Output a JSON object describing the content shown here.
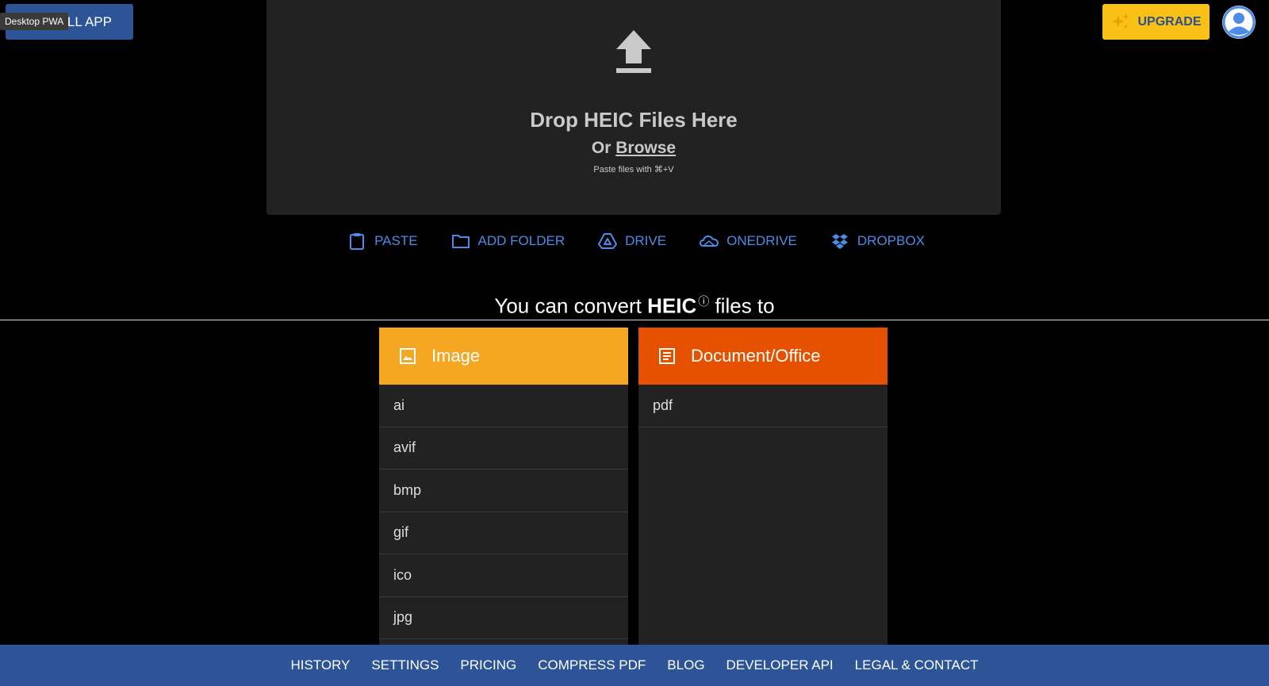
{
  "topbar": {
    "install_label": "INSTALL APP",
    "tooltip": "Desktop PWA",
    "upgrade_label": "UPGRADE"
  },
  "dropzone": {
    "title": "Drop HEIC Files Here",
    "or_text": "Or ",
    "browse_label": "Browse",
    "paste_hint": "Paste files with ⌘+V"
  },
  "sources": [
    {
      "label": "PASTE",
      "icon": "clipboard-icon"
    },
    {
      "label": "ADD FOLDER",
      "icon": "folder-icon"
    },
    {
      "label": "DRIVE",
      "icon": "google-drive-icon"
    },
    {
      "label": "ONEDRIVE",
      "icon": "onedrive-icon"
    },
    {
      "label": "DROPBOX",
      "icon": "dropbox-icon"
    }
  ],
  "heading": {
    "prefix": "You can convert ",
    "format": "HEIC",
    "info_icon": "ⓘ",
    "suffix": " files to"
  },
  "categories": [
    {
      "name": "Image",
      "icon": "image-icon",
      "color": "#f5a623",
      "formats": [
        "ai",
        "avif",
        "bmp",
        "gif",
        "ico",
        "jpg"
      ]
    },
    {
      "name": "Document/Office",
      "icon": "document-icon",
      "color": "#e65100",
      "formats": [
        "pdf"
      ]
    }
  ],
  "bottom_nav": [
    "HISTORY",
    "SETTINGS",
    "PRICING",
    "COMPRESS PDF",
    "BLOG",
    "DEVELOPER API",
    "LEGAL & CONTACT"
  ],
  "colors": {
    "accent_blue": "#4a8ce8",
    "nav_blue": "#2d5496",
    "upgrade_yellow": "#f9c116"
  }
}
